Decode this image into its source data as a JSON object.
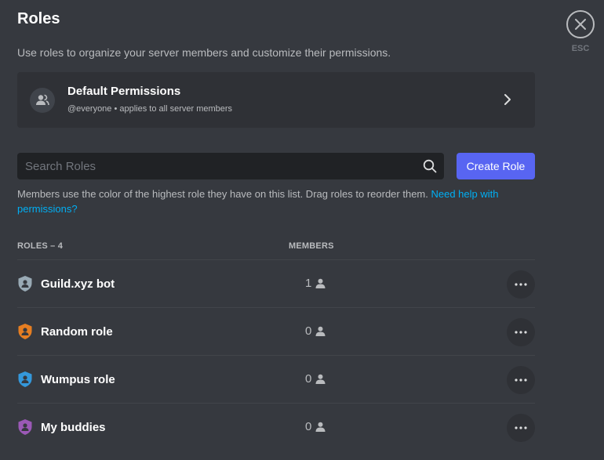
{
  "header": {
    "title": "Roles",
    "description": "Use roles to organize your server members and customize their permissions.",
    "close_label": "ESC"
  },
  "default_permissions": {
    "title": "Default Permissions",
    "subtitle": "@everyone • applies to all server members"
  },
  "search": {
    "placeholder": "Search Roles",
    "value": ""
  },
  "create_button": {
    "label": "Create Role"
  },
  "help": {
    "text": "Members use the color of the highest role they have on this list. Drag roles to reorder them. ",
    "link": "Need help with permissions?"
  },
  "table": {
    "roles_header": "ROLES – 4",
    "members_header": "MEMBERS",
    "rows": [
      {
        "name": "Guild.xyz bot",
        "members": "1",
        "color": "#99aab5"
      },
      {
        "name": "Random role",
        "members": "0",
        "color": "#e67e22"
      },
      {
        "name": "Wumpus role",
        "members": "0",
        "color": "#3498db"
      },
      {
        "name": "My buddies",
        "members": "0",
        "color": "#9b59b6"
      }
    ]
  },
  "colors": {
    "accent": "#5865f2",
    "link": "#00aff4",
    "background": "#36393f"
  }
}
